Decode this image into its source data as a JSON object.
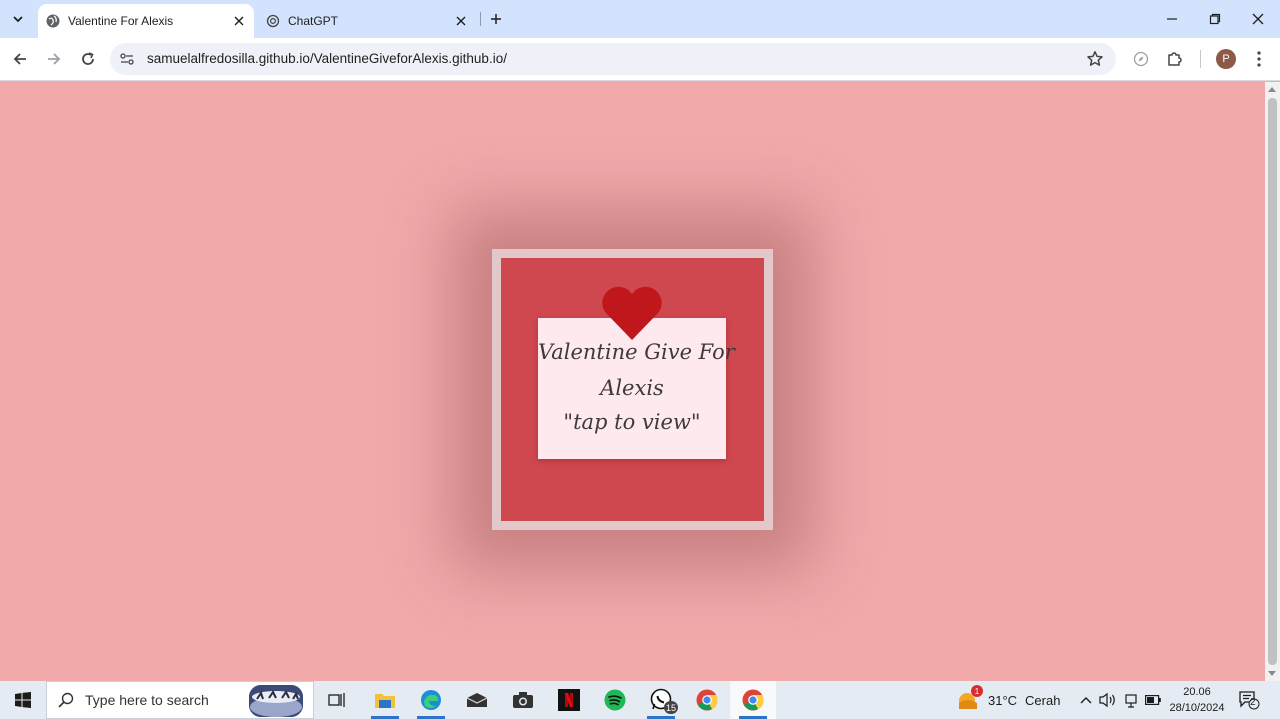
{
  "browser": {
    "tabs": [
      {
        "title": "Valentine For Alexis",
        "favicon": "globe-icon",
        "active": true
      },
      {
        "title": "ChatGPT",
        "favicon": "chatgpt-icon",
        "active": false
      }
    ],
    "url": "samuelalfredosilla.github.io/ValentineGiveforAlexis.github.io/",
    "profile_initial": "P"
  },
  "page": {
    "background_color": "#f1a9aa",
    "card": {
      "line1": "Valentine Give For",
      "line2": "Alexis",
      "line3": "\"tap to view\""
    },
    "colors": {
      "frame": "#e2c8c9",
      "inner": "#d0484f",
      "heart": "#c0171d",
      "letter": "#fde9ee"
    }
  },
  "taskbar": {
    "search_placeholder": "Type here to search",
    "apps": [
      "task-view-icon",
      "file-explorer-icon",
      "edge-icon",
      "mail-icon",
      "camera-icon",
      "netflix-icon",
      "spotify-icon",
      "whatsapp-icon",
      "chrome-icon",
      "chrome-icon"
    ],
    "whatsapp_badge": "15",
    "weather": {
      "temp": "31°C",
      "condition": "Cerah",
      "alert_count": "1"
    },
    "time": "20.06",
    "date": "28/10/2024",
    "notification_count": "2"
  }
}
